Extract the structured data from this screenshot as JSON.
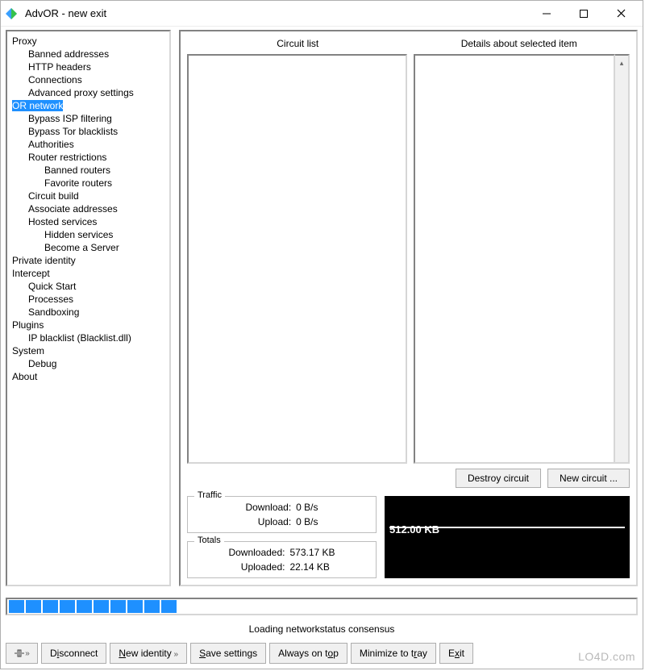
{
  "window": {
    "title": "AdvOR - new exit"
  },
  "tree": [
    {
      "t": "Proxy",
      "l": 0
    },
    {
      "t": "Banned addresses",
      "l": 1
    },
    {
      "t": "HTTP headers",
      "l": 1
    },
    {
      "t": "Connections",
      "l": 1
    },
    {
      "t": "Advanced proxy settings",
      "l": 1
    },
    {
      "t": "OR network",
      "l": 0,
      "sel": true
    },
    {
      "t": "Bypass ISP filtering",
      "l": 1
    },
    {
      "t": "Bypass Tor blacklists",
      "l": 1
    },
    {
      "t": "Authorities",
      "l": 1
    },
    {
      "t": "Router restrictions",
      "l": 1
    },
    {
      "t": "Banned routers",
      "l": 2
    },
    {
      "t": "Favorite routers",
      "l": 2
    },
    {
      "t": "Circuit build",
      "l": 1
    },
    {
      "t": "Associate addresses",
      "l": 1
    },
    {
      "t": "Hosted services",
      "l": 1
    },
    {
      "t": "Hidden services",
      "l": 2
    },
    {
      "t": "Become a Server",
      "l": 2
    },
    {
      "t": "Private identity",
      "l": 0
    },
    {
      "t": "Intercept",
      "l": 0
    },
    {
      "t": "Quick Start",
      "l": 1
    },
    {
      "t": "Processes",
      "l": 1
    },
    {
      "t": "Sandboxing",
      "l": 1
    },
    {
      "t": "Plugins",
      "l": 0
    },
    {
      "t": "IP blacklist (Blacklist.dll)",
      "l": 1
    },
    {
      "t": "System",
      "l": 0
    },
    {
      "t": "Debug",
      "l": 1
    },
    {
      "t": "About",
      "l": 0
    }
  ],
  "panel": {
    "circuit_head": "Circuit list",
    "detail_head": "Details about selected item",
    "destroy": "Destroy circuit",
    "newcircuit": "New circuit ..."
  },
  "traffic": {
    "legend": "Traffic",
    "dl_label": "Download:",
    "dl_value": "0 B/s",
    "ul_label": "Upload:",
    "ul_value": "0 B/s"
  },
  "totals": {
    "legend": "Totals",
    "dl_label": "Downloaded:",
    "dl_value": "573.17 KB",
    "ul_label": "Uploaded:",
    "ul_value": "22.14 KB"
  },
  "graph": {
    "scale": "512.00 KB"
  },
  "status": {
    "blocks": 10,
    "message": "Loading networkstatus consensus"
  },
  "toolbar": {
    "disconnect_pre": "D",
    "disconnect_u": "i",
    "disconnect_post": "sconnect",
    "newid_u": "N",
    "newid_post": "ew identity",
    "save_u": "S",
    "save_post": "ave settings",
    "top_pre": "Always on t",
    "top_u": "o",
    "top_post": "p",
    "min_pre": "Minimize to t",
    "min_u": "r",
    "min_post": "ay",
    "exit_pre": "E",
    "exit_u": "x",
    "exit_post": "it"
  },
  "watermark": "LO4D.com"
}
